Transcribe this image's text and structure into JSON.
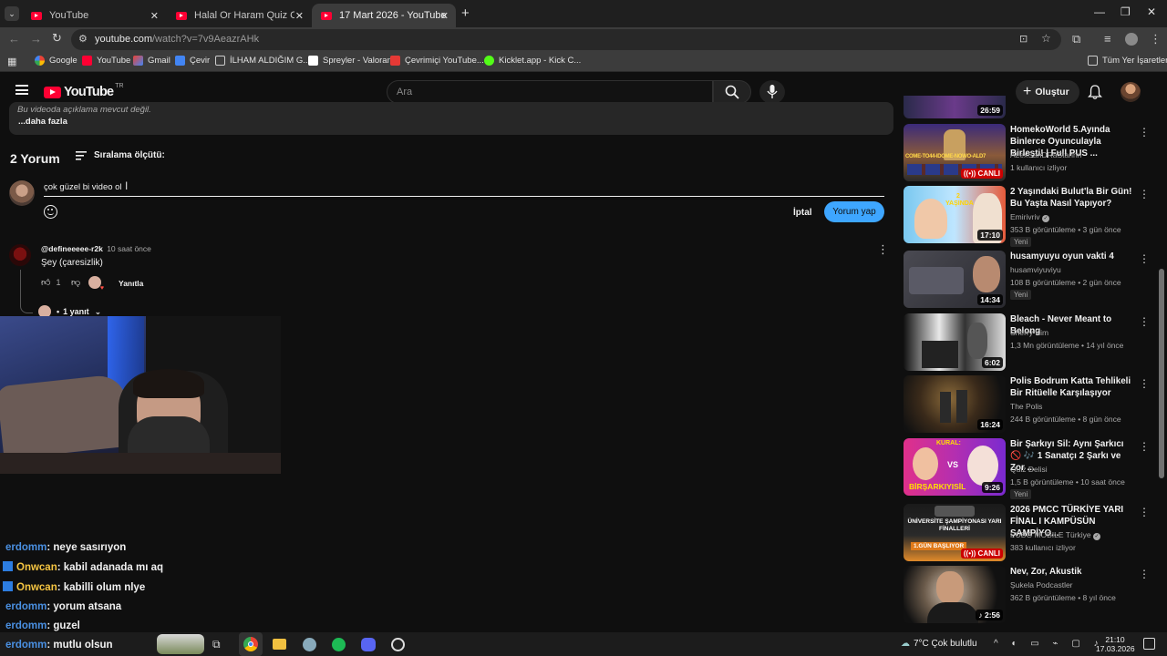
{
  "browser": {
    "tabs": [
      {
        "label": "YouTube"
      },
      {
        "label": "Halal Or Haram Quiz Challenge"
      },
      {
        "label": "17 Mart 2026 - YouTube"
      }
    ],
    "url_host": "youtube.com",
    "url_path": "/watch?v=7v9AeazrAHk",
    "bookmarks": [
      {
        "label": "Google"
      },
      {
        "label": "YouTube"
      },
      {
        "label": "Gmail"
      },
      {
        "label": "Çevir"
      },
      {
        "label": "İLHAM ALDIĞIM G..."
      },
      {
        "label": "Spreyler - Valorant"
      },
      {
        "label": "Çevrimiçi YouTube..."
      },
      {
        "label": "Kicklet.app - Kick C..."
      }
    ],
    "all_bookmarks": "Tüm Yer İşaretleri"
  },
  "youtube": {
    "logo": "YouTube",
    "logo_region": "TR",
    "search_placeholder": "Ara",
    "create_label": "Oluştur"
  },
  "description": {
    "partial": "Bu videoda açıklama mevcut değil.",
    "more": "...daha fazla"
  },
  "comments": {
    "count": "2 Yorum",
    "sort_label": "Sıralama ölçütü:",
    "draft": "çok güzel bi video ol",
    "cancel": "İptal",
    "submit": "Yorum yap",
    "items": [
      {
        "author": "@defineeeee-r2k",
        "time": "10 saat önce",
        "text": "Şey (çaresizlik)",
        "likes": "1",
        "reply": "Yanıtla",
        "replies": "1 yanıt"
      }
    ]
  },
  "chat": [
    {
      "user": "erdomm",
      "message": ": neye sasırıyon",
      "color": "#4a90e2"
    },
    {
      "user": "Onwcan",
      "message": ": kabil adanada mı aq",
      "color": "#f5c542"
    },
    {
      "user": "Onwcan",
      "message": ": kabilli olum nlye",
      "color": "#f5c542"
    },
    {
      "user": "erdomm",
      "message": ": yorum atsana",
      "color": "#4a90e2"
    },
    {
      "user": "erdomm",
      "message": ": guzel",
      "color": "#4a90e2"
    },
    {
      "user": "erdomm",
      "message": ": mutlu olsun",
      "color": "#4a90e2"
    }
  ],
  "sidebar": [
    {
      "title": "",
      "meta1": "",
      "meta2": "",
      "duration": "26:59",
      "live": false,
      "badge": ""
    },
    {
      "title": "HomekoWorld 5.Ayında Binlerce Oyunculayla Birleşti! | Full PUS ...",
      "meta1": "ALexSanDRaStannn",
      "meta2": "1 kullanıcı izliyor",
      "duration": "",
      "live": true,
      "live_label": "CANLI",
      "badge": ""
    },
    {
      "title": "2 Yaşındaki Bulut'la Bir Gün! Bu Yaşta Nasıl Yapıyor?",
      "meta1": "Emirivriv",
      "meta2": "353 B görüntüleme • 3 gün önce",
      "duration": "17:10",
      "live": false,
      "badge": "Yeni"
    },
    {
      "title": "husamyuyu oyun vakti 4",
      "meta1": "husamviyuviyu",
      "meta2": "108 B görüntüleme • 2 gün önce",
      "duration": "14:34",
      "live": false,
      "badge": "Yeni"
    },
    {
      "title": "Bleach - Never Meant to Belong",
      "meta1": "Sherry Kim",
      "meta2": "1,3 Mn görüntüleme • 14 yıl önce",
      "duration": "6:02",
      "live": false,
      "badge": ""
    },
    {
      "title": "Polis Bodrum Katta Tehlikeli Bir Ritüelle Karşılaşıyor",
      "meta1": "The Polis",
      "meta2": "244 B görüntüleme • 8 gün önce",
      "duration": "16:24",
      "live": false,
      "badge": ""
    },
    {
      "title": "Bir Şarkıyı Sil: Aynı Şarkıcı 🚫 🎶 1 Sanatçı 2 Şarkı ve Zor ...",
      "meta1": "Quiz Delisi",
      "meta2": "1,5 B görüntüleme • 10 saat önce",
      "duration": "9:26",
      "live": false,
      "badge": "Yeni"
    },
    {
      "title": "2026 PMCC TÜRKİYE YARI FİNAL I KAMPÜSÜN ŞAMPİYO...",
      "meta1": "PUBG MOBILE Türkiye",
      "meta2": "383 kullanıcı izliyor",
      "duration": "",
      "live": true,
      "live_label": "CANLI",
      "badge": ""
    },
    {
      "title": "Nev, Zor, Akustik",
      "meta1": "Şukela Podcastler",
      "meta2": "362 B görüntüleme • 8 yıl önce",
      "duration": "2:56",
      "live": false,
      "badge": ""
    }
  ],
  "thumb_text": {
    "kural": "KURAL:",
    "birsarkiyi": "BİRŞARKIYISİL",
    "vs": "VS",
    "universite": "ÜNİVERSİTE ŞAMPİYONASI YARI FİNALLERİ",
    "gun": "1.GÜN BAŞLIYOR",
    "yasinda": "2 YAŞINDA",
    "come": "COME-TO44-IDOME-NOWO-ALD7"
  },
  "taskbar": {
    "weather": "7°C  Çok bulutlu",
    "time": "21:10",
    "date": "17.03.2026"
  }
}
